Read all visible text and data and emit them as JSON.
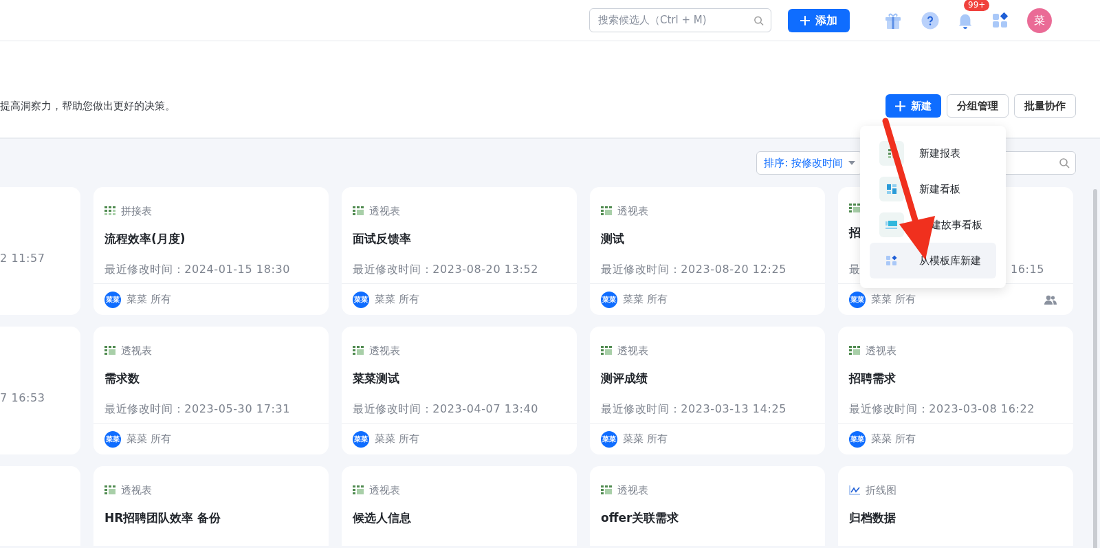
{
  "topbar": {
    "search": {
      "placeholder": "搜索候选人（Ctrl + M)"
    },
    "add_button": "添加",
    "notifications_badge": "99+",
    "avatar": "菜"
  },
  "header": {
    "description": "提高洞察力，帮助您做出更好的决策。",
    "buttons": [
      {
        "label": "新建",
        "kind": "primary"
      },
      {
        "label": "分组管理",
        "kind": "outline"
      },
      {
        "label": "批量协作",
        "kind": "outline"
      }
    ]
  },
  "new_menu": {
    "items": [
      {
        "label": "新建报表",
        "kind": "report",
        "selected": false
      },
      {
        "label": "新建看板",
        "kind": "board",
        "selected": false
      },
      {
        "label": "建故事看板",
        "kind": "story",
        "selected": false
      },
      {
        "label": "从模板库新建",
        "kind": "template",
        "selected": true
      }
    ]
  },
  "toolbar": {
    "sort": "排序: 按修改时间"
  },
  "card_rows": [
    {
      "partial": {
        "modified": "2 11:57"
      },
      "cards": [
        {
          "type": "拼接表",
          "kind": "stitch",
          "title": "流程效率(月度)",
          "modified": "最近修改时间：2024-01-15 18:30",
          "owner_avatar": "菜菜",
          "owner": "菜菜 所有",
          "shared": false
        },
        {
          "type": "透视表",
          "kind": "pivot",
          "title": "面试反馈率",
          "modified": "最近修改时间：2023-08-20 13:52",
          "owner_avatar": "菜菜",
          "owner": "菜菜 所有",
          "shared": false
        },
        {
          "type": "透视表",
          "kind": "pivot",
          "title": "测试",
          "modified": "最近修改时间：2023-08-20 12:25",
          "owner_avatar": "菜菜",
          "owner": "菜菜 所有",
          "shared": false
        },
        {
          "kind": "pivot",
          "title": "招",
          "modified_start": "最",
          "modified_end": "16:15",
          "owner_avatar": "菜菜",
          "owner": "菜菜 所有",
          "shared": true
        }
      ]
    },
    {
      "partial": {
        "modified": "7 16:53"
      },
      "cards": [
        {
          "type": "透视表",
          "kind": "pivot",
          "title": "需求数",
          "modified": "最近修改时间：2023-05-30 17:31",
          "owner_avatar": "菜菜",
          "owner": "菜菜 所有",
          "shared": false
        },
        {
          "type": "透视表",
          "kind": "pivot",
          "title": "菜菜测试",
          "modified": "最近修改时间：2023-04-07 13:40",
          "owner_avatar": "菜菜",
          "owner": "菜菜 所有",
          "shared": false
        },
        {
          "type": "透视表",
          "kind": "pivot",
          "title": "测评成绩",
          "modified": "最近修改时间：2023-03-13 14:25",
          "owner_avatar": "菜菜",
          "owner": "菜菜 所有",
          "shared": false
        },
        {
          "type": "透视表",
          "kind": "pivot",
          "title": "招聘需求",
          "modified": "最近修改时间：2023-03-08 16:22",
          "owner_avatar": "菜菜",
          "owner": "菜菜 所有",
          "shared": false
        }
      ]
    },
    {
      "partial": {},
      "cards": [
        {
          "type": "透视表",
          "kind": "pivot",
          "title": "HR招聘团队效率 备份"
        },
        {
          "type": "透视表",
          "kind": "pivot",
          "title": "候选人信息"
        },
        {
          "type": "透视表",
          "kind": "pivot",
          "title": "offer关联需求"
        },
        {
          "type": "折线图",
          "kind": "line",
          "title": "归档数据"
        }
      ]
    }
  ]
}
